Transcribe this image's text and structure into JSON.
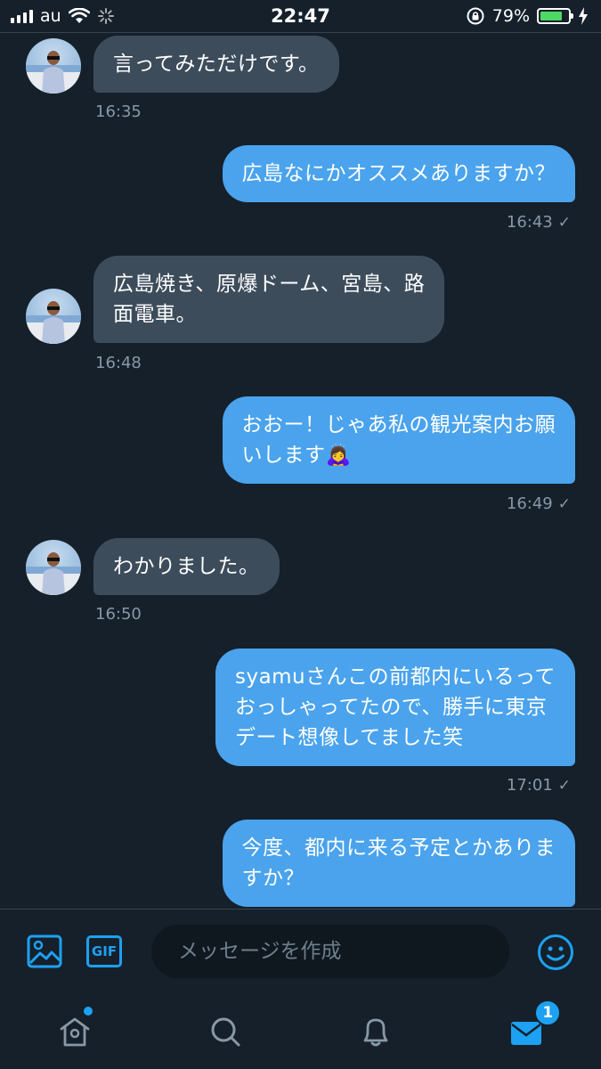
{
  "status_bar": {
    "carrier": "au",
    "time": "22:47",
    "battery_percent": "79%",
    "battery_level": 0.79,
    "icons": [
      "signal-icon",
      "wifi-icon",
      "loading-icon",
      "rotation-lock-icon",
      "battery-icon",
      "charging-icon"
    ]
  },
  "messages": [
    {
      "direction": "in",
      "text": "言ってみただけです。",
      "time": "16:35"
    },
    {
      "direction": "out",
      "text": "広島なにかオススメありますか？",
      "time": "16:43"
    },
    {
      "direction": "in",
      "text": "広島焼き、原爆ドーム、宮島、路\n面電車。",
      "time": "16:48"
    },
    {
      "direction": "out",
      "text": "おおー！じゃあ私の観光案内お願\nいします🙇‍♀️",
      "time": "16:49"
    },
    {
      "direction": "in",
      "text": "わかりました。",
      "time": "16:50"
    },
    {
      "direction": "out",
      "text": "syamuさんこの前都内にいるって\nおっしゃってたので、勝手に東京\nデート想像してました笑",
      "time": "17:01"
    },
    {
      "direction": "out",
      "text": "今度、都内に来る予定とかありま\nすか？",
      "time": ""
    }
  ],
  "composer": {
    "placeholder": "メッセージを作成",
    "gif_label": "GIF",
    "icons": [
      "image-icon",
      "gif-icon",
      "emoji-icon"
    ]
  },
  "tab_bar": {
    "tabs": [
      "home-icon",
      "search-icon",
      "notifications-icon",
      "messages-icon"
    ],
    "messages_badge": "1"
  },
  "colors": {
    "background": "#15202b",
    "incoming_bubble": "#3d4c5b",
    "outgoing_bubble": "#4aa3ec",
    "accent": "#1da1f2",
    "timestamp": "#8899a6"
  }
}
